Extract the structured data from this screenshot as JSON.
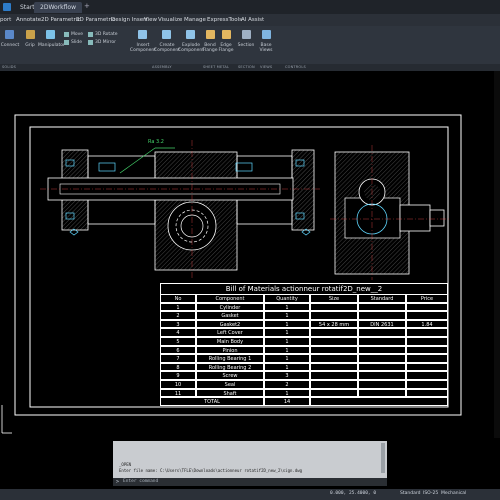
{
  "titlebar": {
    "tabs": [
      {
        "label": "Start"
      },
      {
        "label": "2DWorkflow"
      }
    ]
  },
  "menubar": {
    "items": [
      "port",
      "Annotate",
      "2D Parametric",
      "3D Parametric",
      "Design Insert",
      "View",
      "Visualize",
      "Manage",
      "ExpressTools",
      "AI Assist"
    ]
  },
  "ribbon": {
    "buttons": [
      {
        "label": "Connect"
      },
      {
        "label": "Grip"
      },
      {
        "label": "Manipulator"
      },
      {
        "label": "Move"
      },
      {
        "label": "3D Rotate"
      },
      {
        "label": "Slide"
      },
      {
        "label": "3D Mirror"
      },
      {
        "label": "Insert Component"
      },
      {
        "label": "Create Component"
      },
      {
        "label": "Explode Component"
      },
      {
        "label": "Bend Flange"
      },
      {
        "label": "Edge Flange"
      },
      {
        "label": "Section"
      },
      {
        "label": "Base Views"
      }
    ],
    "panels": [
      "SOLIDS",
      "ASSEMBLY",
      "SHEET METAL",
      "SECTION",
      "VIEWS",
      "CONTROLS"
    ]
  },
  "drawing": {
    "leader_label": "Ra 3.2",
    "bom": {
      "title": "Bill of Materials actionneur rotatif2D_new__2",
      "columns": [
        "No",
        "Component",
        "Quantity",
        "Size",
        "Standard",
        "Price"
      ],
      "rows": [
        [
          "1",
          "Cylinder",
          "1",
          "",
          "",
          ""
        ],
        [
          "2",
          "Gasket",
          "1",
          "",
          "",
          ""
        ],
        [
          "3",
          "Gasket2",
          "1",
          "54 x 28 mm",
          "DIN 2631",
          "1.84"
        ],
        [
          "4",
          "Left Cover",
          "1",
          "",
          "",
          ""
        ],
        [
          "5",
          "Main Body",
          "1",
          "",
          "",
          ""
        ],
        [
          "6",
          "Pinion",
          "1",
          "",
          "",
          ""
        ],
        [
          "7",
          "Rolling Bearing 1",
          "1",
          "",
          "",
          ""
        ],
        [
          "8",
          "Rolling Bearing 2",
          "1",
          "",
          "",
          ""
        ],
        [
          "9",
          "Screw",
          "3",
          "",
          "",
          ""
        ],
        [
          "10",
          "Seal",
          "2",
          "",
          "",
          ""
        ],
        [
          "11",
          "Shaft",
          "1",
          "",
          "",
          ""
        ]
      ],
      "total_label": "TOTAL",
      "total_qty": "14"
    }
  },
  "command": {
    "history": [
      "_OPEN",
      "Enter file name: C:\\Users\\TFLE\\Downloads\\actionneur rotatif2D_new_2\\sign.dwg"
    ],
    "prompt": "Enter command"
  },
  "statusbar": {
    "coords": "0.000, 25.4000, 0",
    "fields": [
      "Standard",
      "ISO-25",
      "Mechanical"
    ]
  },
  "colors": {
    "linework": "#ffffff",
    "cyan": "#5fd7ff",
    "green": "#44d36b",
    "hatch": "#cfcfcf"
  }
}
